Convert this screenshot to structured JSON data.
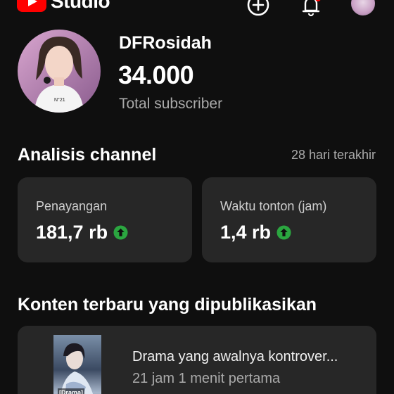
{
  "app": {
    "logo_text": "Studio",
    "brand_color": "#ff0000"
  },
  "header_icons": {
    "create": "add-circle-icon",
    "notifications": "bell-icon",
    "account": "account-avatar"
  },
  "channel": {
    "name": "DFRosidah",
    "subscriber_count": "34.000",
    "subscriber_label": "Total subscriber",
    "avatar_caption": "N°21"
  },
  "analytics": {
    "title": "Analisis channel",
    "period": "28 hari terakhir",
    "trend_color": "#2ba640",
    "cards": [
      {
        "label": "Penayangan",
        "value": "181,7 rb",
        "trend": "up"
      },
      {
        "label": "Waktu tonton (jam)",
        "value": "1,4 rb",
        "trend": "up"
      }
    ]
  },
  "recent_content": {
    "title": "Konten terbaru yang dipublikasikan",
    "items": [
      {
        "title": "Drama yang awalnya kontrover...",
        "meta": "21 jam 1 menit pertama",
        "thumbnail_caption": "[Drama]"
      }
    ]
  }
}
